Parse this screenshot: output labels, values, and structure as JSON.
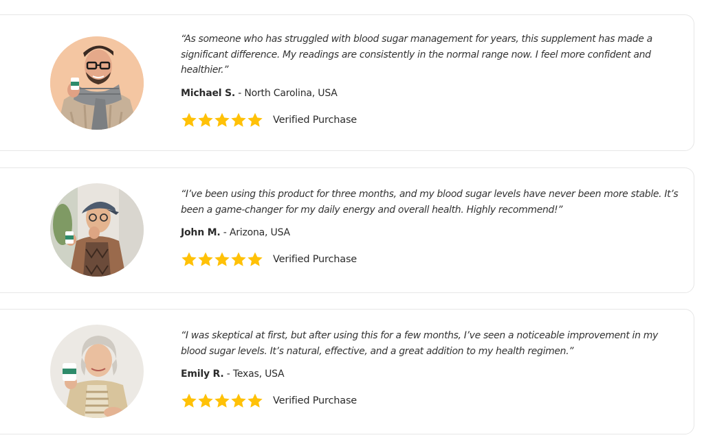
{
  "testimonials": [
    {
      "quote": "“As someone who has struggled with blood sugar management for years, this supplement has made a significant difference. My readings are consistently in the normal range now. I feel more confident and healthier.”",
      "name": "Michael S.",
      "location": " - North Carolina, USA",
      "rating": 5,
      "verified": "Verified Purchase",
      "avatar": "man-in-scarf-avatar"
    },
    {
      "quote": "“I’ve been using this product for three months, and my blood sugar levels have never been more stable. It’s been a game-changer for my daily energy and overall health. Highly recommend!”",
      "name": "John M.",
      "location": " - Arizona, USA",
      "rating": 5,
      "verified": "Verified Purchase",
      "avatar": "elderly-man-avatar"
    },
    {
      "quote": "“I was skeptical at first, but after using this for a few months, I’ve seen a noticeable improvement in my blood sugar levels. It’s natural, effective, and a great addition to my health regimen.”",
      "name": "Emily R.",
      "location": " - Texas, USA",
      "rating": 5,
      "verified": "Verified Purchase",
      "avatar": "elderly-woman-avatar"
    }
  ],
  "colors": {
    "star": "#FFC107",
    "card_border": "#E6E6E6",
    "text": "#2B2B2B"
  }
}
